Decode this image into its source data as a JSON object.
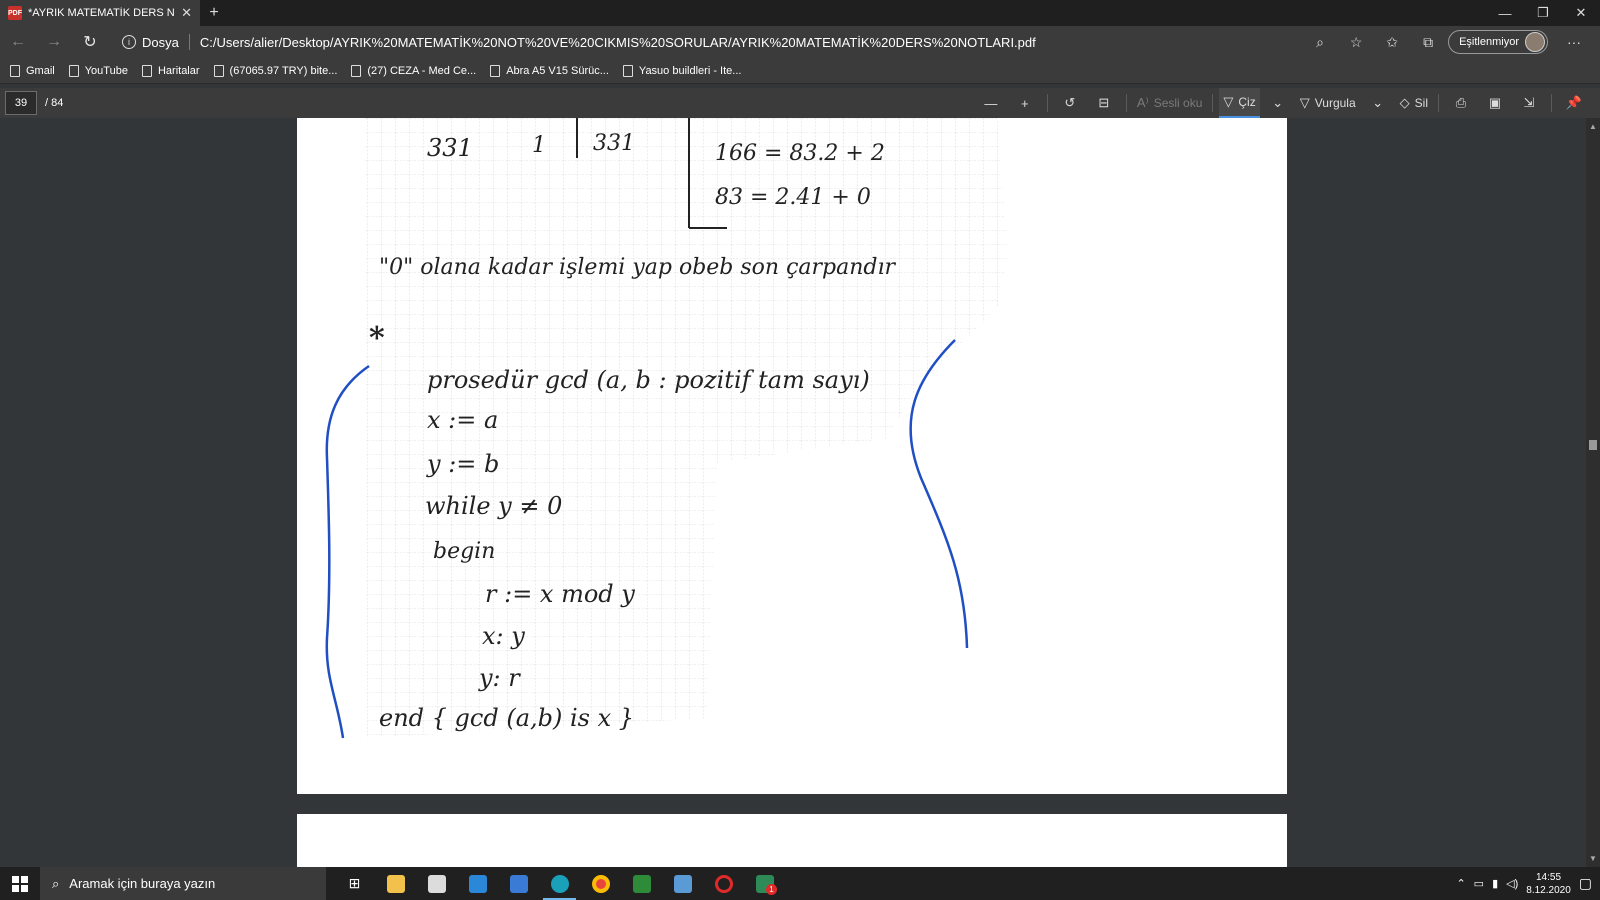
{
  "tab": {
    "title": "*AYRIK MATEMATİK DERS NOTL/",
    "pdf_badge": "PDF"
  },
  "address": {
    "security_label": "Dosya",
    "url": "C:/Users/alier/Desktop/AYRIK%20MATEMATİK%20NOT%20VE%20CIKMIS%20SORULAR/AYRIK%20MATEMATİK%20DERS%20NOTLARI.pdf",
    "sync_label": "Eşitlenmiyor"
  },
  "bookmarks": [
    "Gmail",
    "YouTube",
    "Haritalar",
    "(67065.97 TRY) bite...",
    "(27) CEZA - Med Ce...",
    "Abra A5 V15 Sürüc...",
    "Yasuo buildleri - Ite..."
  ],
  "pdf_toolbar": {
    "current_page": "39",
    "total_pages": "/ 84",
    "read_aloud": "Sesli oku",
    "draw": "Çiz",
    "highlight": "Vurgula",
    "erase": "Sil"
  },
  "taskbar": {
    "search_placeholder": "Aramak için buraya yazın",
    "time": "14:55",
    "date": "8.12.2020",
    "mail_badge": "1"
  },
  "handwriting": {
    "row1_a": "331",
    "row1_b": "1",
    "row1_c": "331",
    "eq1": "166 = 83.2 + 2",
    "eq2": "83 = 2.41 + 0",
    "note": "\"0\" olana kadar işlemi yap obeb son çarpandır",
    "star": "*",
    "line1": "prosedür gcd (a, b : pozitif tam sayı)",
    "line2": "x := a",
    "line3": "y := b",
    "line4": "while y ≠ 0",
    "line5": "begin",
    "line6": "r := x mod y",
    "line7": "x: y",
    "line8": "y: r",
    "line9": "end { gcd (a,b) is x }"
  },
  "colors": {
    "ink": "#222222",
    "pen": "#1f4fc2",
    "accent": "#4a90e2"
  }
}
